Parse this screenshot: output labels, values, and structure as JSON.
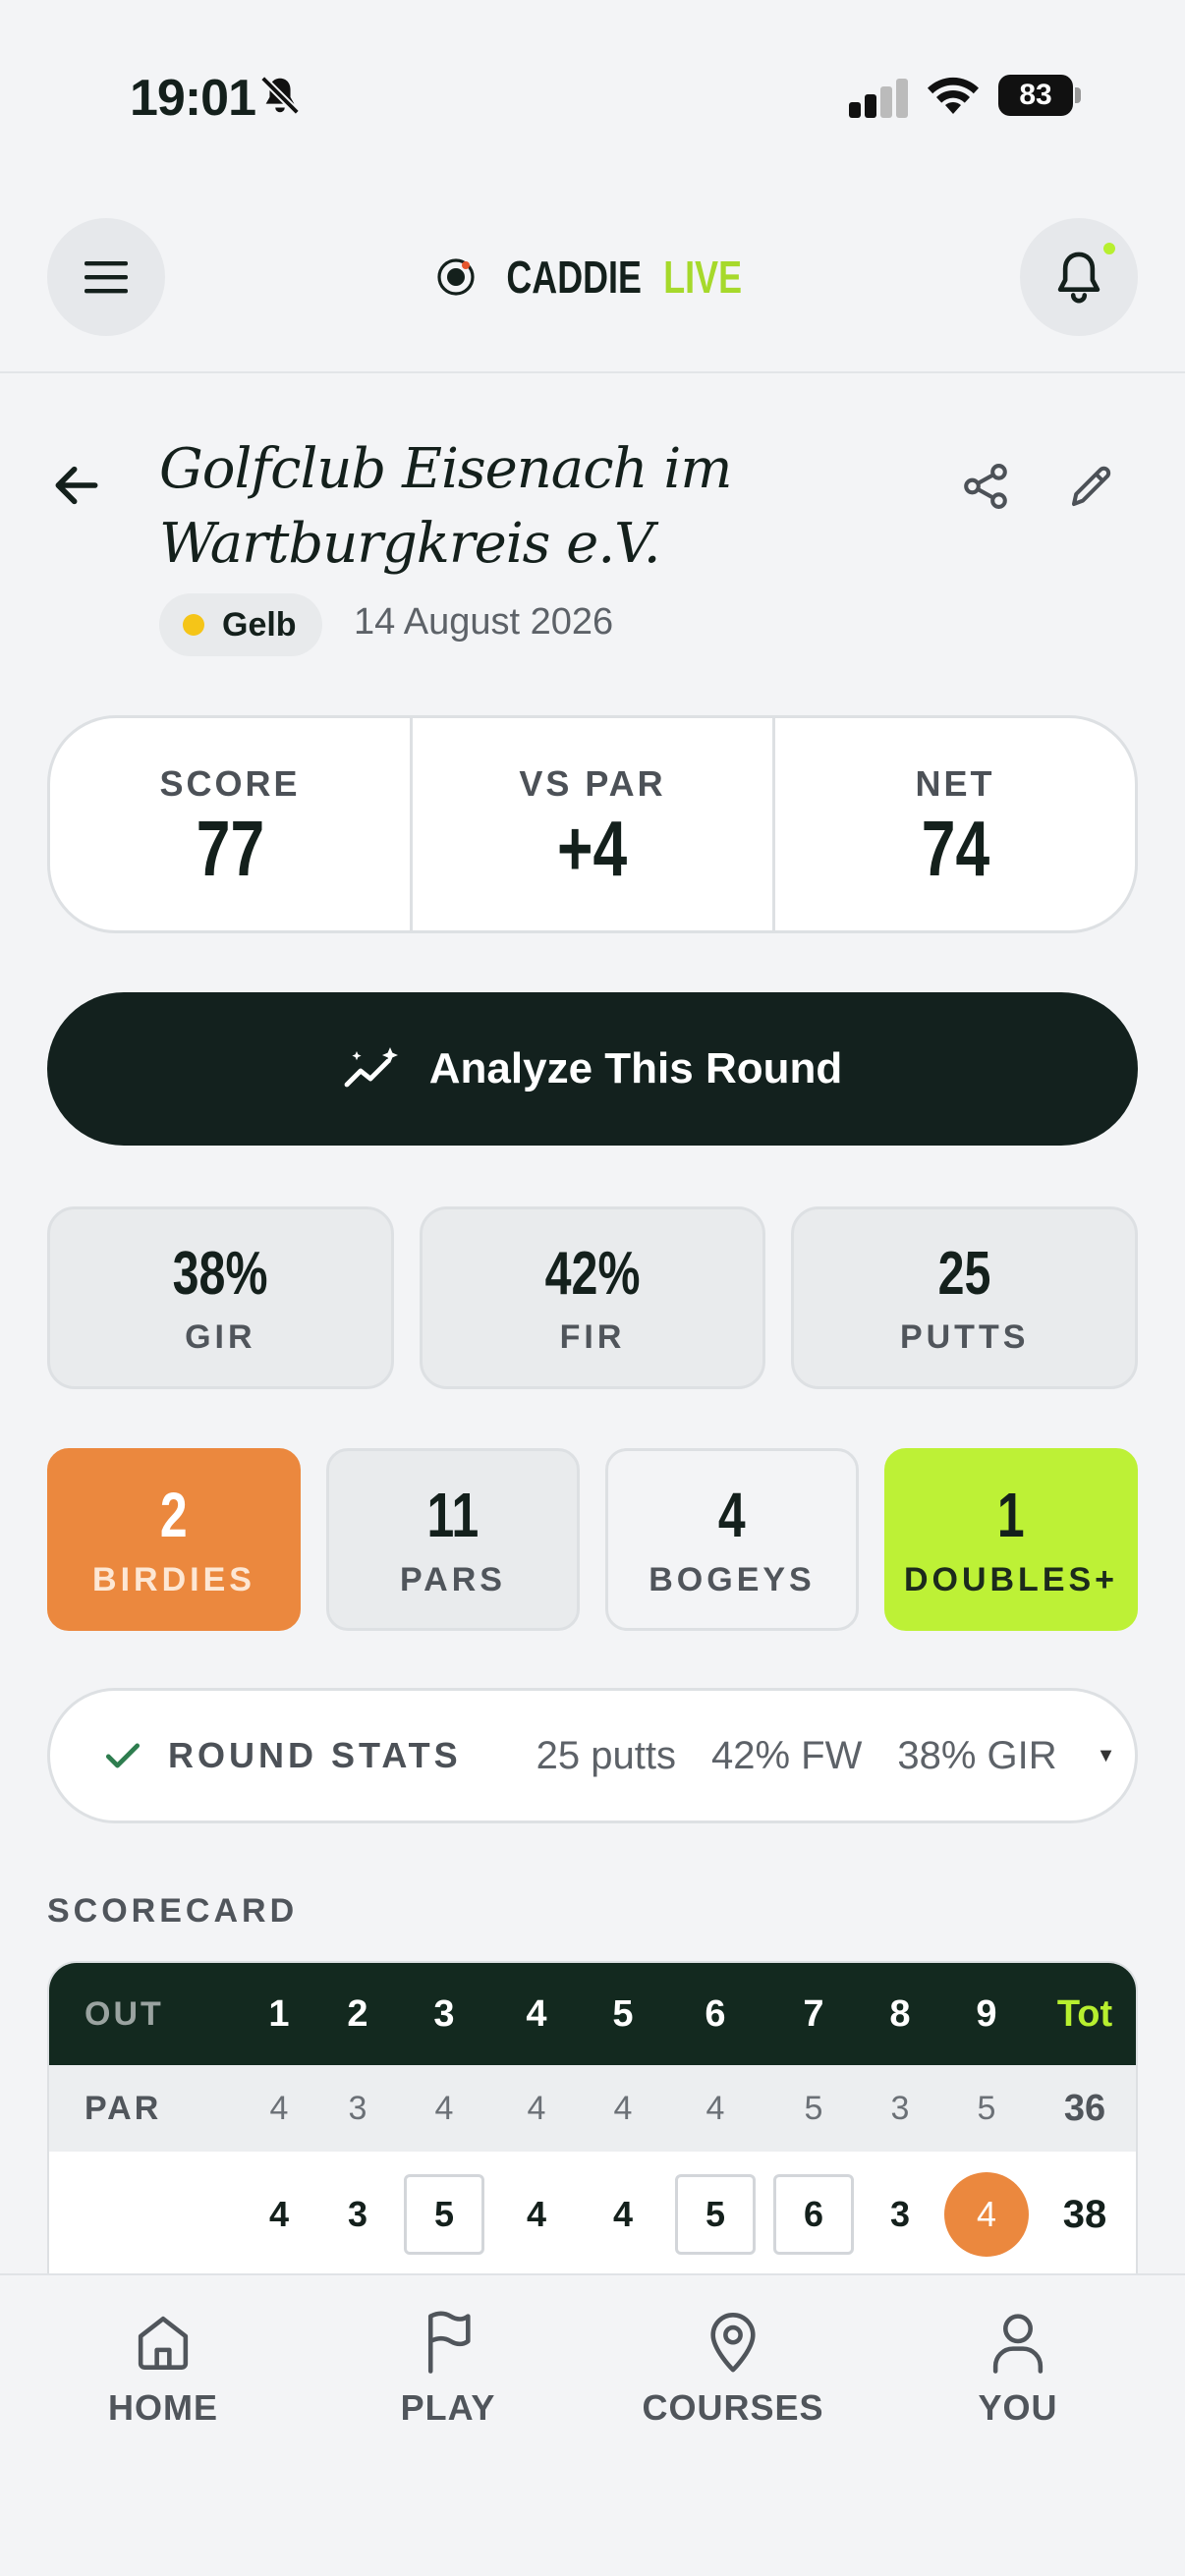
{
  "status_bar": {
    "time": "19:01",
    "battery": "83"
  },
  "header": {
    "brand_caddie": "CADDIE",
    "brand_live": "LIVE"
  },
  "round": {
    "course_name": "Golfclub Eisenach im Wartburgkreis e.V.",
    "tee": "Gelb",
    "tee_color": "#f5c518",
    "date": "14 August 2026"
  },
  "summary": [
    {
      "label": "SCORE",
      "value": "77"
    },
    {
      "label": "VS PAR",
      "value": "+4"
    },
    {
      "label": "NET",
      "value": "74"
    }
  ],
  "analyze_button": {
    "label": "Analyze This Round"
  },
  "stats": [
    {
      "value": "38%",
      "label": "GIR"
    },
    {
      "value": "42%",
      "label": "FIR"
    },
    {
      "value": "25",
      "label": "PUTTS"
    }
  ],
  "results": [
    {
      "value": "2",
      "label": "BIRDIES",
      "color": "#eb883e"
    },
    {
      "value": "11",
      "label": "PARS"
    },
    {
      "value": "4",
      "label": "BOGEYS"
    },
    {
      "value": "1",
      "label": "DOUBLES+",
      "color": "#bdf136"
    }
  ],
  "round_stats": {
    "title": "ROUND STATS",
    "putts": "25 putts",
    "fairways": "42% FW",
    "gir": "38% GIR",
    "caret": "▼"
  },
  "scorecard": {
    "section_label": "SCORECARD",
    "out_label": "OUT",
    "par_label": "PAR",
    "holes": [
      "1",
      "2",
      "3",
      "4",
      "5",
      "6",
      "7",
      "8",
      "9"
    ],
    "total_label": "Tot",
    "pars": [
      "4",
      "3",
      "4",
      "4",
      "4",
      "4",
      "5",
      "3",
      "5"
    ],
    "par_total": "36",
    "scores": [
      "4",
      "3",
      "5",
      "4",
      "4",
      "5",
      "6",
      "3",
      "4"
    ],
    "score_styles": [
      "plain",
      "plain",
      "box",
      "plain",
      "plain",
      "box",
      "box",
      "plain",
      "circle"
    ],
    "score_total": "38"
  },
  "nav": [
    {
      "label": "HOME",
      "icon": "home-icon"
    },
    {
      "label": "PLAY",
      "icon": "flag-icon"
    },
    {
      "label": "COURSES",
      "icon": "map-pin-icon"
    },
    {
      "label": "YOU",
      "icon": "user-icon"
    }
  ]
}
